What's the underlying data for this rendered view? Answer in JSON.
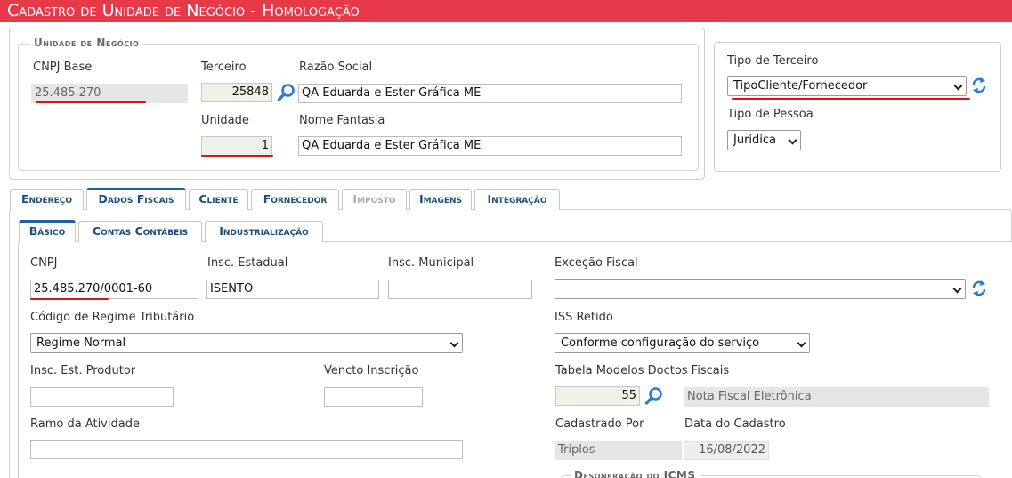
{
  "title": "Cadastro de Unidade de Negócio  - Homologação",
  "unidade": {
    "legend": "Unidade de Negócio",
    "cnpj_base_label": "CNPJ Base",
    "cnpj_base_value": "25.485.270",
    "terceiro_label": "Terceiro",
    "terceiro_value": "25848",
    "razao_label": "Razão Social",
    "razao_value": "QA Eduarda e Ester Gráfica ME",
    "unidade_label": "Unidade",
    "unidade_value": "1",
    "fantasia_label": "Nome Fantasia",
    "fantasia_value": "QA Eduarda e Ester Gráfica ME"
  },
  "tipo": {
    "terceiro_label": "Tipo de Terceiro",
    "terceiro_value": "TipoCliente/Fornecedor",
    "pessoa_label": "Tipo de Pessoa",
    "pessoa_value": "Jurídica"
  },
  "tabs": [
    "Endereço",
    "Dados Fiscais",
    "Cliente",
    "Fornecedor",
    "Imposto",
    "Imagens",
    "Integração"
  ],
  "subtabs": [
    "Básico",
    "Contas Contábeis",
    "Industrialização"
  ],
  "fiscal": {
    "cnpj_label": "CNPJ",
    "cnpj_value": "25.485.270/0001-60",
    "ie_label": "Insc. Estadual",
    "ie_value": "ISENTO",
    "im_label": "Insc. Municipal",
    "im_value": "",
    "excecao_label": "Exceção Fiscal",
    "excecao_value": "",
    "regime_label": "Código de Regime Tributário",
    "regime_value": "Regime Normal",
    "iss_label": "ISS Retido",
    "iss_value": "Conforme configuração do serviço",
    "produtor_label": "Insc. Est. Produtor",
    "produtor_value": "",
    "vencto_label": "Vencto Inscrição",
    "vencto_value": "",
    "modelos_label": "Tabela Modelos Doctos Fiscais",
    "modelos_code": "55",
    "modelos_desc": "Nota Fiscal Eletrônica",
    "ramo_label": "Ramo da Atividade",
    "ramo_value": "",
    "cad_por_label": "Cadastrado Por",
    "cad_por_value": "Triplos",
    "data_cad_label": "Data do Cadastro",
    "data_cad_value": "16/08/2022",
    "desoneracao_legend": "Desoneração do ICMS"
  },
  "colors": {
    "title_bar": "#e8394a",
    "highlight": "#e0101f",
    "tab_text": "#1b4e7b",
    "icon_blue": "#2b7bd1"
  },
  "icons": [
    "search-icon",
    "refresh-icon",
    "chevron-down-icon"
  ]
}
